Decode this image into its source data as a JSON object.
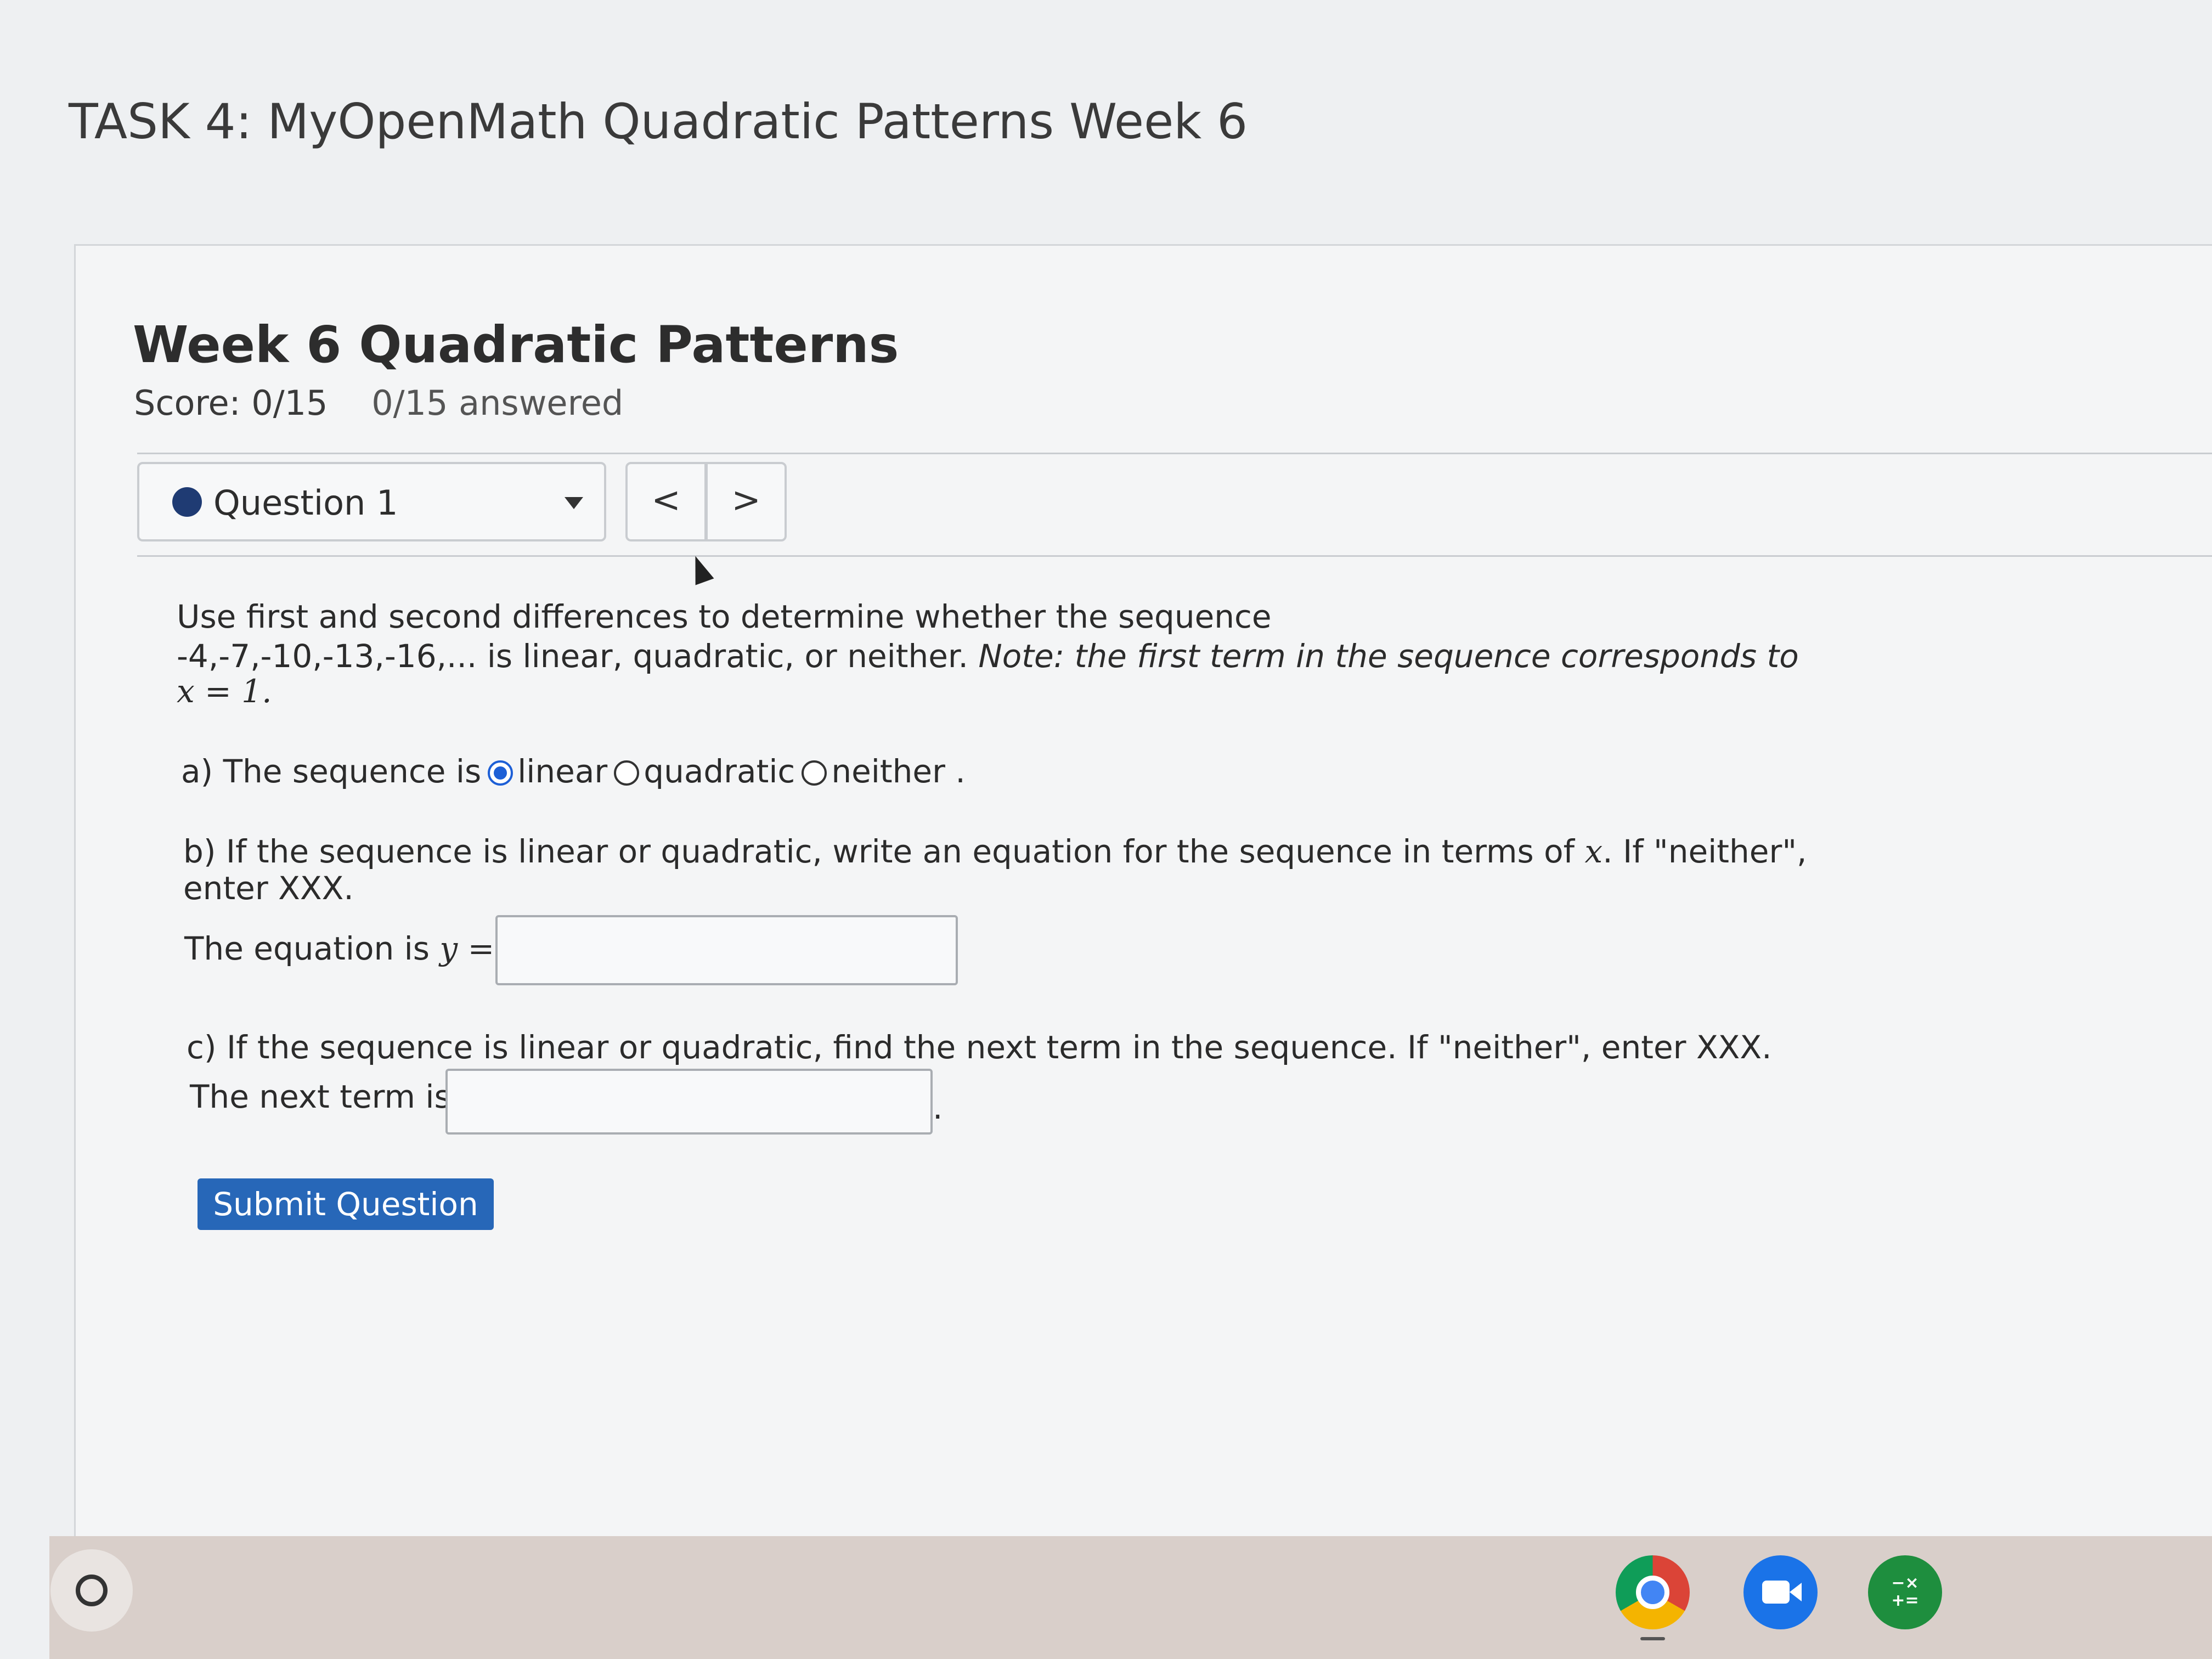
{
  "page": {
    "task_title": "TASK 4: MyOpenMath Quadratic Patterns Week 6"
  },
  "assessment": {
    "title": "Week 6 Quadratic Patterns",
    "score": "Score: 0/15",
    "answered": "0/15 answered"
  },
  "question_nav": {
    "selected": "Question 1",
    "prev_label": "<",
    "next_label": ">"
  },
  "question": {
    "prompt_line1": "Use first and second differences to determine whether the sequence",
    "prompt_line2_plain": "-4,-7,-10,-13,-16,... is linear, quadratic, or neither.",
    "prompt_line2_note": "Note: the first term in the sequence corresponds to",
    "prompt_line3": "x = 1.",
    "part_a": {
      "lead": "a) The sequence is",
      "options": [
        "linear",
        "quadratic",
        "neither"
      ],
      "selected": "linear",
      "trail": "."
    },
    "part_b": {
      "text_line1_start": "b) If the sequence is linear or quadratic, write an equation for the sequence in terms of",
      "text_var": "x",
      "text_line1_end": ". If \"neither\",",
      "text_line2": "enter XXX.",
      "label": "The equation is",
      "label_math": "y =",
      "value": ""
    },
    "part_c": {
      "text": "c) If the sequence is linear or quadratic, find the next term in the sequence. If \"neither\", enter XXX.",
      "label": "The next term is",
      "value": "",
      "trail": "."
    },
    "submit_label": "Submit Question"
  },
  "shelf": {
    "apps": [
      "chrome-icon",
      "video-camera-icon",
      "calculator-icon"
    ]
  }
}
